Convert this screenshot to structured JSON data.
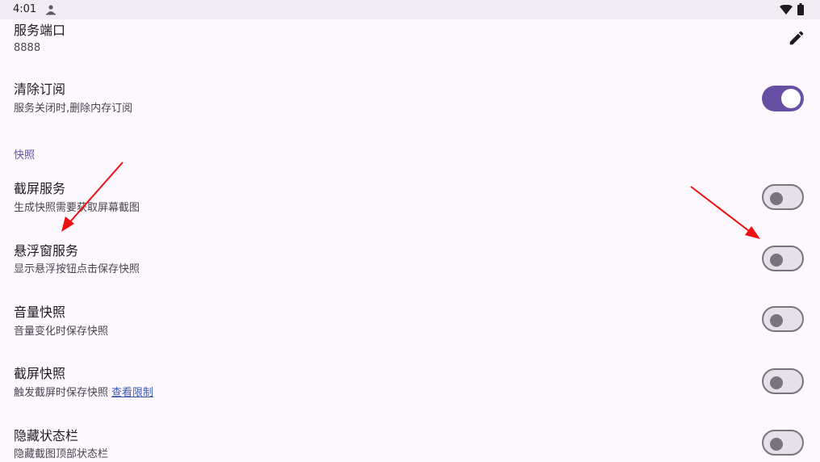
{
  "status_bar": {
    "time": "4:01",
    "icons": [
      "user-icon",
      "wifi-icon",
      "battery-icon"
    ]
  },
  "settings": {
    "service_port": {
      "title": "服务端口",
      "value": "8888",
      "action_icon": "edit-icon"
    },
    "clear_subscription": {
      "title": "清除订阅",
      "summary": "服务关闭时,删除内存订阅",
      "enabled": true
    },
    "snapshot_section": {
      "header": "快照"
    },
    "screenshot_service": {
      "title": "截屏服务",
      "summary": "生成快照需要获取屏幕截图",
      "enabled": false
    },
    "floating_window_service": {
      "title": "悬浮窗服务",
      "summary": "显示悬浮按钮点击保存快照",
      "enabled": false
    },
    "volume_snapshot": {
      "title": "音量快照",
      "summary": "音量变化时保存快照",
      "enabled": false
    },
    "screenshot_snapshot": {
      "title": "截屏快照",
      "summary": "触发截屏时保存快照",
      "link": "查看限制",
      "enabled": false
    },
    "hide_status_bar": {
      "title": "隐藏状态栏",
      "summary": "隐藏截图顶部状态栏",
      "enabled": false
    }
  },
  "colors": {
    "background": "#fdf7fe",
    "accent": "#6750a4",
    "annotation_arrow": "#ee1111"
  }
}
